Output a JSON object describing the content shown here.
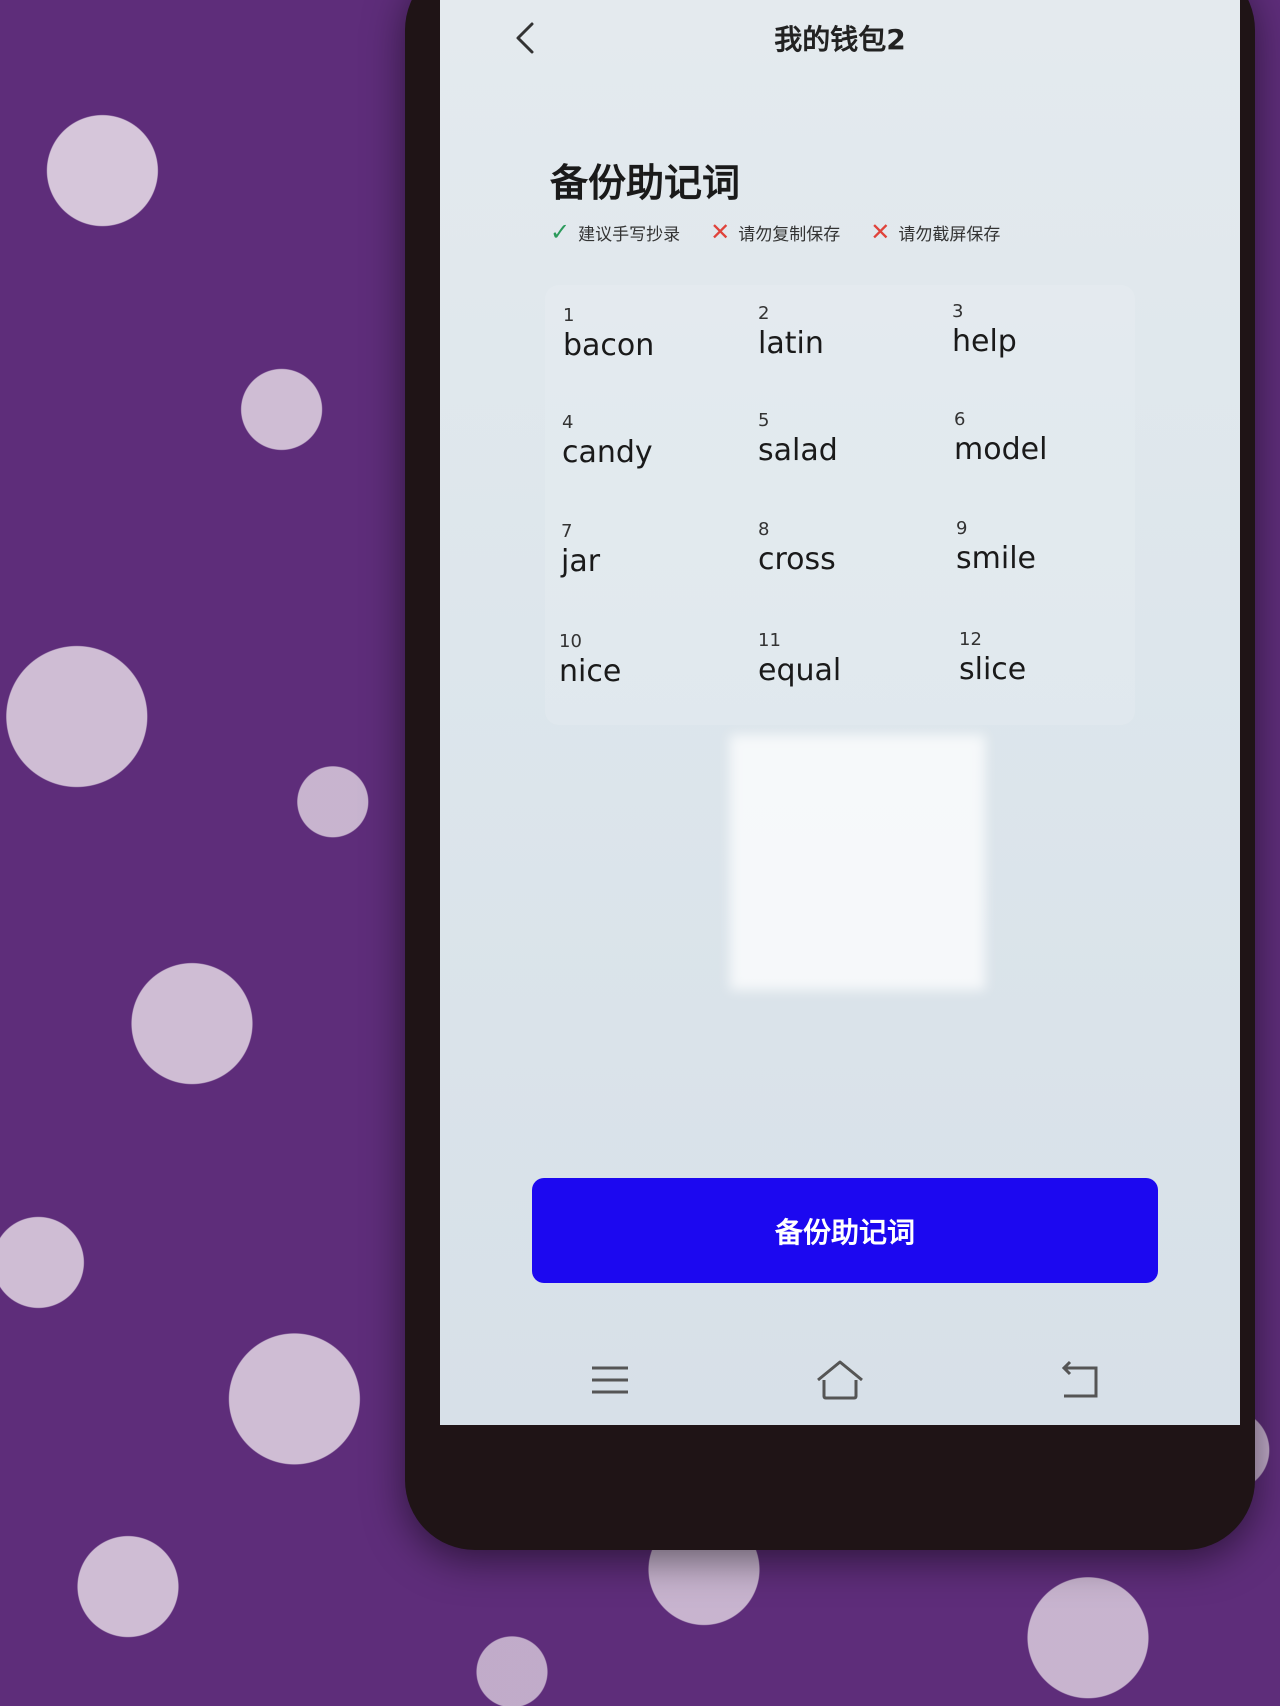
{
  "header": {
    "wallet_name": "我的钱包2"
  },
  "section": {
    "title": "备份助记词"
  },
  "hints": [
    {
      "icon": "check-icon",
      "text": "建议手写抄录"
    },
    {
      "icon": "cross-icon",
      "text": "请勿复制保存"
    },
    {
      "icon": "cross-icon",
      "text": "请勿截屏保存"
    }
  ],
  "mnemonic": [
    {
      "index": "1",
      "word": "bacon"
    },
    {
      "index": "2",
      "word": "latin"
    },
    {
      "index": "3",
      "word": "help"
    },
    {
      "index": "4",
      "word": "candy"
    },
    {
      "index": "5",
      "word": "salad"
    },
    {
      "index": "6",
      "word": "model"
    },
    {
      "index": "7",
      "word": "jar"
    },
    {
      "index": "8",
      "word": "cross"
    },
    {
      "index": "9",
      "word": "smile"
    },
    {
      "index": "10",
      "word": "nice"
    },
    {
      "index": "11",
      "word": "equal"
    },
    {
      "index": "12",
      "word": "slice"
    }
  ],
  "action": {
    "backup_label": "备份助记词"
  },
  "colors": {
    "primary_button": "#1c08f0",
    "check": "#2b9a5b",
    "cross": "#e0433b"
  },
  "navbar": {
    "icons": [
      "menu-icon",
      "home-icon",
      "back-nav-icon"
    ]
  }
}
